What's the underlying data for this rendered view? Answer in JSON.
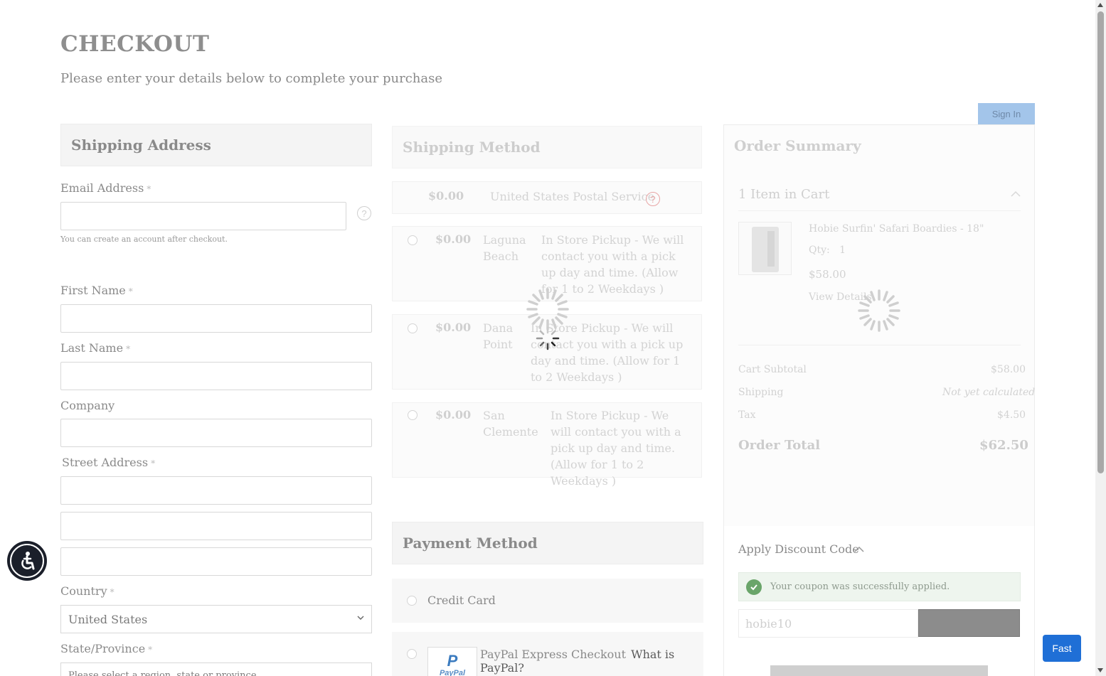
{
  "page": {
    "title": "CHECKOUT",
    "subtitle": "Please enter your details below to complete your purchase",
    "sign_in_label": "Sign In"
  },
  "shipping_address": {
    "heading": "Shipping Address",
    "email_label": "Email Address",
    "email_hint": "You can create an account after checkout.",
    "first_name_label": "First Name",
    "last_name_label": "Last Name",
    "company_label": "Company",
    "street_label": "Street Address",
    "country_label": "Country",
    "country_value": "United States",
    "state_label": "State/Province",
    "state_placeholder": "Please select a region, state or province.",
    "required_mark": "*",
    "help_glyph": "?"
  },
  "shipping_method": {
    "heading": "Shipping Method",
    "options": [
      {
        "price": "$0.00",
        "carrier": "United States Postal Service"
      },
      {
        "price": "$0.00",
        "location": "Laguna Beach",
        "description": "In Store Pickup - We will contact you with a pick up day and time. (Allow for 1 to 2 Weekdays )"
      },
      {
        "price": "$0.00",
        "location": "Dana Point",
        "description": "In Store Pickup - We will contact you with a pick up day and time. (Allow for 1 to 2 Weekdays )"
      },
      {
        "price": "$0.00",
        "location": "San Clemente",
        "description": "In Store Pickup - We will contact you with a pick up day and time. (Allow for 1 to 2 Weekdays )"
      }
    ]
  },
  "payment_method": {
    "heading": "Payment Method",
    "credit_card_label": "Credit Card",
    "paypal_label": "PayPal Express Checkout",
    "paypal_link": "What is PayPal?",
    "paypal_logo_text": "PayPal"
  },
  "order_summary": {
    "heading": "Order Summary",
    "items_in_cart": "1 Item in Cart",
    "product_name": "Hobie Surfin' Safari Boardies - 18\"",
    "qty_label": "Qty:",
    "qty_value": "1",
    "product_price": "$58.00",
    "view_details": "View Details",
    "cart_subtotal_label": "Cart Subtotal",
    "cart_subtotal_value": "$58.00",
    "shipping_label": "Shipping",
    "shipping_value": "Not yet calculated",
    "tax_label": "Tax",
    "tax_value": "$4.50",
    "order_total_label": "Order Total",
    "order_total_value": "$62.50"
  },
  "discount": {
    "heading": "Apply Discount Code",
    "success_message": "Your coupon was successfully applied.",
    "code_value": "hobie10"
  },
  "widgets": {
    "fast_label": "Fast"
  },
  "colors": {
    "accent_blue": "#1f6fd6",
    "sign_in_bg": "#a3c5ea",
    "success_green": "#6aa56a"
  }
}
